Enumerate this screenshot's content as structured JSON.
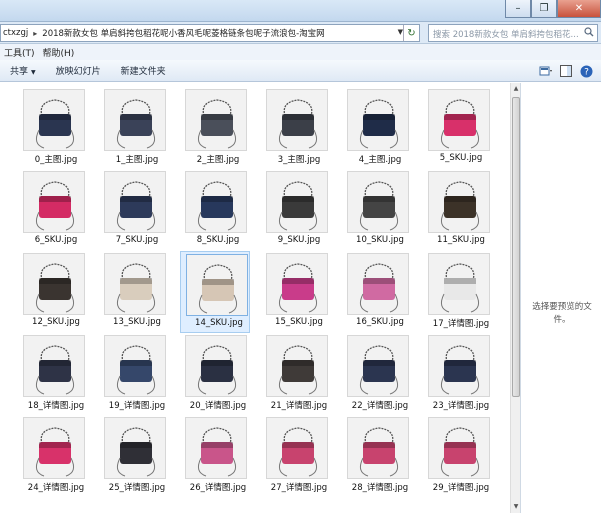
{
  "window": {
    "minimize": "–",
    "restore": "❐",
    "close": "✕"
  },
  "address": {
    "segments": [
      "ctxzgj",
      "2018新款女包 单肩斜挎包稻花呢小香风毛呢菱格链条包呢子流浪包-淘宝网"
    ]
  },
  "search": {
    "placeholder": "搜索 2018新款女包 单肩斜挎包稻花..."
  },
  "menu": {
    "items": [
      "工具(T)",
      "帮助(H)"
    ]
  },
  "toolbar": {
    "share": "共享",
    "slideshow": "放映幻灯片",
    "new_folder": "新建文件夹"
  },
  "preview": {
    "message": "选择要预览的文件。"
  },
  "files": [
    {
      "name": "0_主图.jpg",
      "color": "#2a3550"
    },
    {
      "name": "1_主图.jpg",
      "color": "#3a4258"
    },
    {
      "name": "2_主图.jpg",
      "color": "#4a4f5a"
    },
    {
      "name": "3_主图.jpg",
      "color": "#3b3f48"
    },
    {
      "name": "4_主图.jpg",
      "color": "#1f2c48"
    },
    {
      "name": "5_SKU.jpg",
      "color": "#d8306a"
    },
    {
      "name": "6_SKU.jpg",
      "color": "#d42b64"
    },
    {
      "name": "7_SKU.jpg",
      "color": "#2d3a5a"
    },
    {
      "name": "8_SKU.jpg",
      "color": "#27385c"
    },
    {
      "name": "9_SKU.jpg",
      "color": "#3a3a3a"
    },
    {
      "name": "10_SKU.jpg",
      "color": "#444444"
    },
    {
      "name": "11_SKU.jpg",
      "color": "#3c3228"
    },
    {
      "name": "12_SKU.jpg",
      "color": "#3a3430"
    },
    {
      "name": "13_SKU.jpg",
      "color": "#d9cdbd"
    },
    {
      "name": "14_SKU.jpg",
      "color": "#d6c6b5"
    },
    {
      "name": "15_SKU.jpg",
      "color": "#c93c8a"
    },
    {
      "name": "16_SKU.jpg",
      "color": "#d06aa2"
    },
    {
      "name": "17_详情图.jpg",
      "color": "#e8e8e8"
    },
    {
      "name": "18_详情图.jpg",
      "color": "#2e3346"
    },
    {
      "name": "19_详情图.jpg",
      "color": "#35476a"
    },
    {
      "name": "20_详情图.jpg",
      "color": "#2a3042"
    },
    {
      "name": "21_详情图.jpg",
      "color": "#3f3a38"
    },
    {
      "name": "22_详情图.jpg",
      "color": "#2b3550"
    },
    {
      "name": "23_详情图.jpg",
      "color": "#2b3550"
    },
    {
      "name": "24_详情图.jpg",
      "color": "#d8326a"
    },
    {
      "name": "25_详情图.jpg",
      "color": "#2f2f36"
    },
    {
      "name": "26_详情图.jpg",
      "color": "#c9558a"
    },
    {
      "name": "27_详情图.jpg",
      "color": "#c8436e"
    },
    {
      "name": "28_详情图.jpg",
      "color": "#c8436e"
    },
    {
      "name": "29_详情图.jpg",
      "color": "#c8436e"
    }
  ],
  "selected_index": 14
}
